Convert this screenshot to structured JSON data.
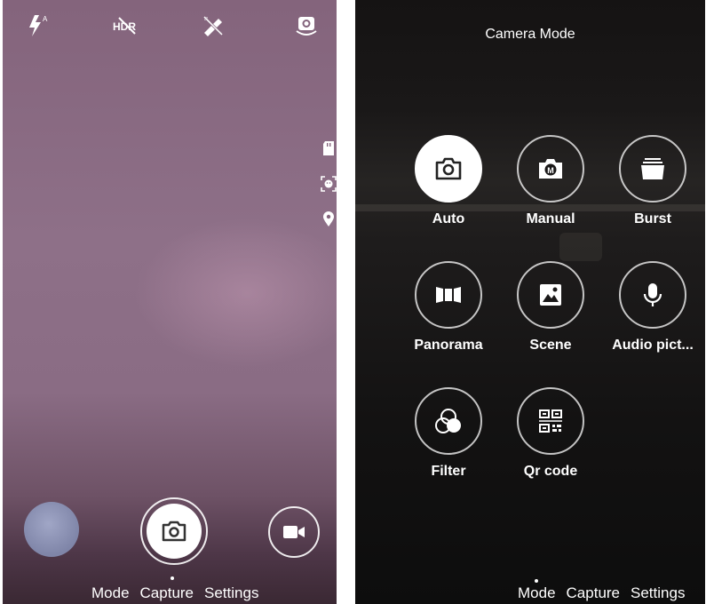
{
  "left": {
    "top_icons": [
      "flash-auto-icon",
      "hdr-off-icon",
      "beauty-off-icon",
      "switch-camera-icon"
    ],
    "hdr_text": "HDR",
    "side_icons": [
      "sd-card-icon",
      "face-detect-icon",
      "location-icon"
    ],
    "nav": {
      "mode": "Mode",
      "capture": "Capture",
      "settings": "Settings",
      "active": "Capture"
    }
  },
  "right": {
    "title": "Camera Mode",
    "modes": [
      {
        "label": "Auto",
        "icon": "camera-icon",
        "active": true
      },
      {
        "label": "Manual",
        "icon": "manual-camera-icon",
        "active": false
      },
      {
        "label": "Burst",
        "icon": "burst-icon",
        "active": false
      },
      {
        "label": "Panorama",
        "icon": "panorama-icon",
        "active": false
      },
      {
        "label": "Scene",
        "icon": "scene-icon",
        "active": false
      },
      {
        "label": "Audio pict...",
        "icon": "microphone-icon",
        "active": false
      },
      {
        "label": "Filter",
        "icon": "filter-icon",
        "active": false
      },
      {
        "label": "Qr code",
        "icon": "qr-code-icon",
        "active": false
      }
    ],
    "nav": {
      "mode": "Mode",
      "capture": "Capture",
      "settings": "Settings",
      "active": "Mode"
    }
  },
  "colors": {
    "divider": "#000000",
    "accent": "#ffffff"
  }
}
